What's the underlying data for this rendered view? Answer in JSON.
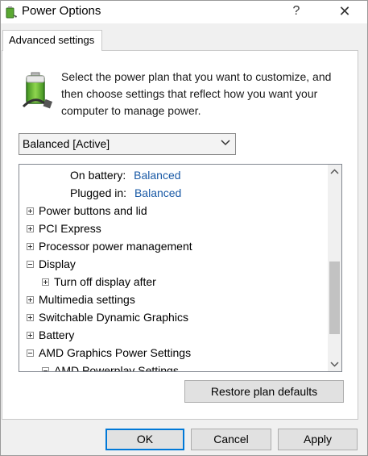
{
  "window": {
    "title": "Power Options",
    "help_label": "?",
    "close_label": "✕"
  },
  "tab": {
    "label": "Advanced settings"
  },
  "intro_text": "Select the power plan that you want to customize, and then choose settings that reflect how you want your computer to manage power.",
  "plan_select": {
    "value": "Balanced [Active]"
  },
  "tree": {
    "rows": [
      {
        "label": "On battery:",
        "value": "Balanced"
      },
      {
        "label": "Plugged in:",
        "value": "Balanced"
      },
      {
        "label": "Power buttons and lid"
      },
      {
        "label": "PCI Express"
      },
      {
        "label": "Processor power management"
      },
      {
        "label": "Display"
      },
      {
        "label": "Turn off display after"
      },
      {
        "label": "Multimedia settings"
      },
      {
        "label": "Switchable Dynamic Graphics"
      },
      {
        "label": "Battery"
      },
      {
        "label": "AMD Graphics Power Settings"
      },
      {
        "label": "AMD Powerplay Settings"
      }
    ],
    "scroll_position": 0.62
  },
  "buttons": {
    "restore": "Restore plan defaults",
    "ok": "OK",
    "cancel": "Cancel",
    "apply": "Apply"
  },
  "colors": {
    "link": "#1a5aa6",
    "focus": "#0078d7"
  }
}
